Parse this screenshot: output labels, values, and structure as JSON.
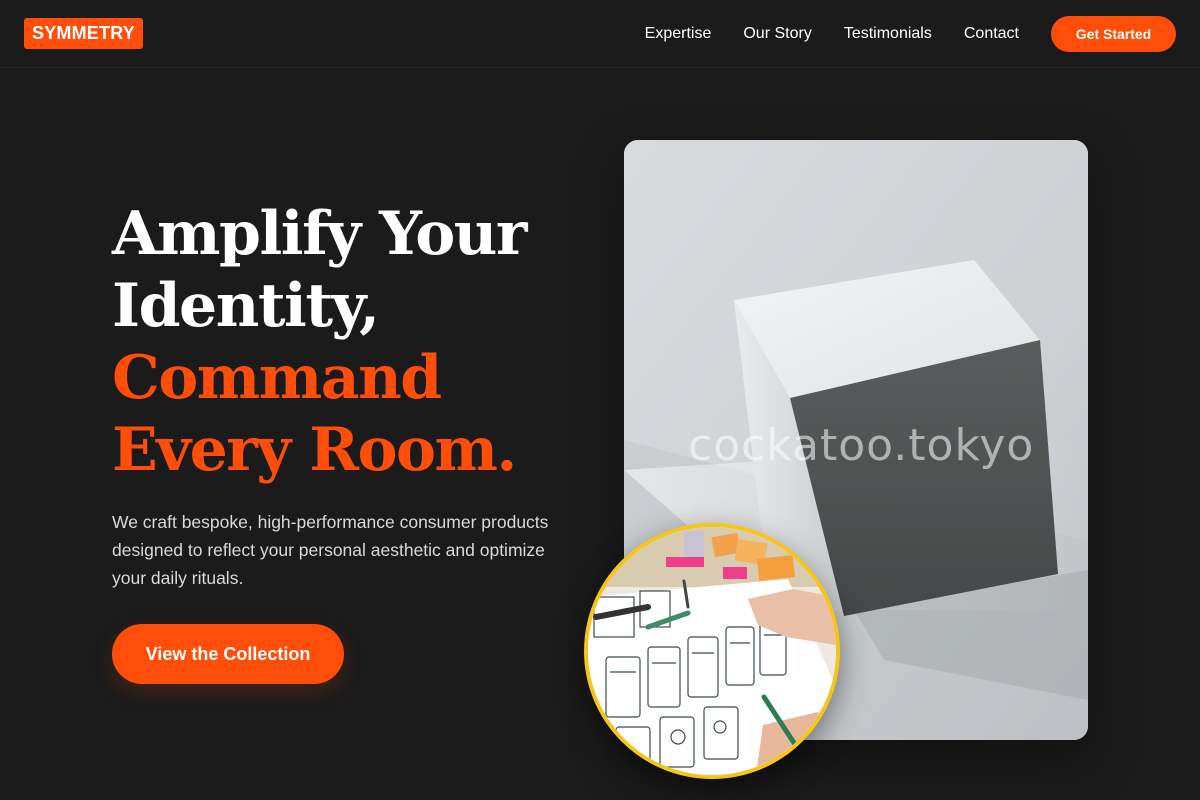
{
  "brand": {
    "logo_text": "SYMMETRY",
    "accent_color": "#ff4d0a",
    "ring_color": "#f5c518"
  },
  "nav": {
    "links": [
      "Expertise",
      "Our Story",
      "Testimonials",
      "Contact"
    ],
    "cta_label": "Get Started"
  },
  "hero": {
    "title_lines": [
      "Amplify Your",
      "Identity,"
    ],
    "accent_lines": [
      "Command",
      "Every Room."
    ],
    "subtitle": "We craft bespoke, high-performance consumer products designed to reflect your personal aesthetic and optimize your daily rituals.",
    "button_label": "View the Collection",
    "image_watermark": "cockatoo.tokyo"
  }
}
